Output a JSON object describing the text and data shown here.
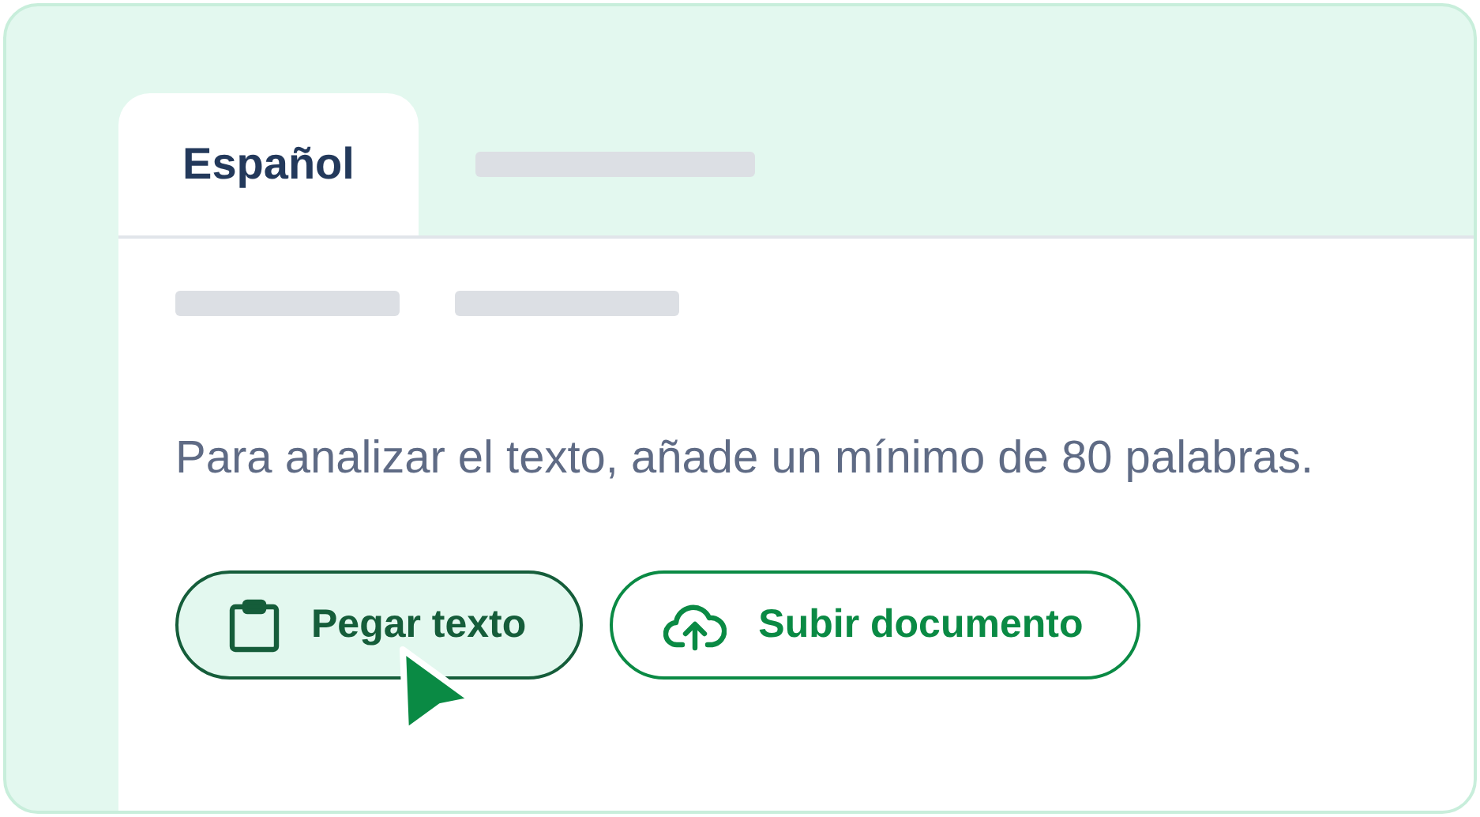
{
  "tabs": [
    {
      "label": "Español",
      "selected": true
    }
  ],
  "message": "Para analizar el texto, añade un mínimo de 80 palabras.",
  "buttons": [
    {
      "kind": "paste",
      "label": "Pegar texto",
      "hovered": true
    },
    {
      "kind": "upload",
      "label": "Subir documento",
      "hovered": false
    }
  ]
}
